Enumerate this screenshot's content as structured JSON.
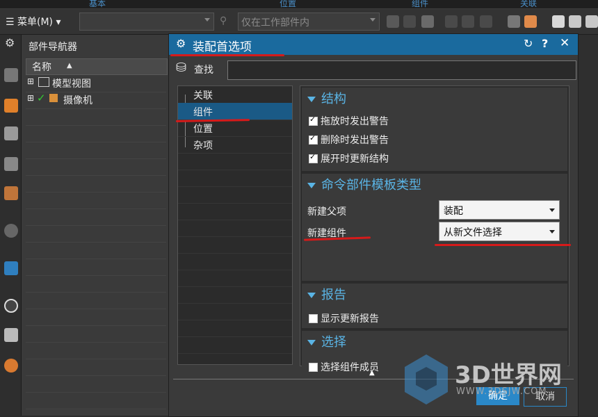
{
  "ribbon": {
    "groups": [
      "基本",
      "位置",
      "组件",
      "关联"
    ]
  },
  "toolbar": {
    "menu_label": "菜单(M)",
    "filter_placeholder": "仅在工作部件内"
  },
  "navigator": {
    "title": "部件导航器",
    "column_header": "名称",
    "items": [
      {
        "label": "模型视图"
      },
      {
        "label": "摄像机"
      }
    ]
  },
  "dialog": {
    "title": "装配首选项",
    "search_label": "查找",
    "search_value": "",
    "tree": [
      "关联",
      "组件",
      "位置",
      "杂项"
    ],
    "selected_tree_index": 1,
    "sections": {
      "structure": {
        "title": "结构",
        "options": [
          {
            "label": "拖放时发出警告",
            "checked": true
          },
          {
            "label": "删除时发出警告",
            "checked": true
          },
          {
            "label": "展开时更新结构",
            "checked": true
          }
        ]
      },
      "template": {
        "title": "命令部件模板类型",
        "new_parent_label": "新建父项",
        "new_parent_value": "装配",
        "new_component_label": "新建组件",
        "new_component_value": "从新文件选择"
      },
      "report": {
        "title": "报告",
        "options": [
          {
            "label": "显示更新报告",
            "checked": false
          }
        ]
      },
      "selection": {
        "title": "选择",
        "options": [
          {
            "label": "选择组件成员",
            "checked": false
          }
        ]
      }
    },
    "buttons": {
      "ok": "确定",
      "cancel": "取消"
    }
  },
  "watermark": {
    "brand": "3D世界网",
    "url": "WWW.3DSJW.COM"
  },
  "colors": {
    "accent": "#1a6a9e",
    "section_title": "#5ab4e5",
    "annotation": "#d61a1a"
  }
}
